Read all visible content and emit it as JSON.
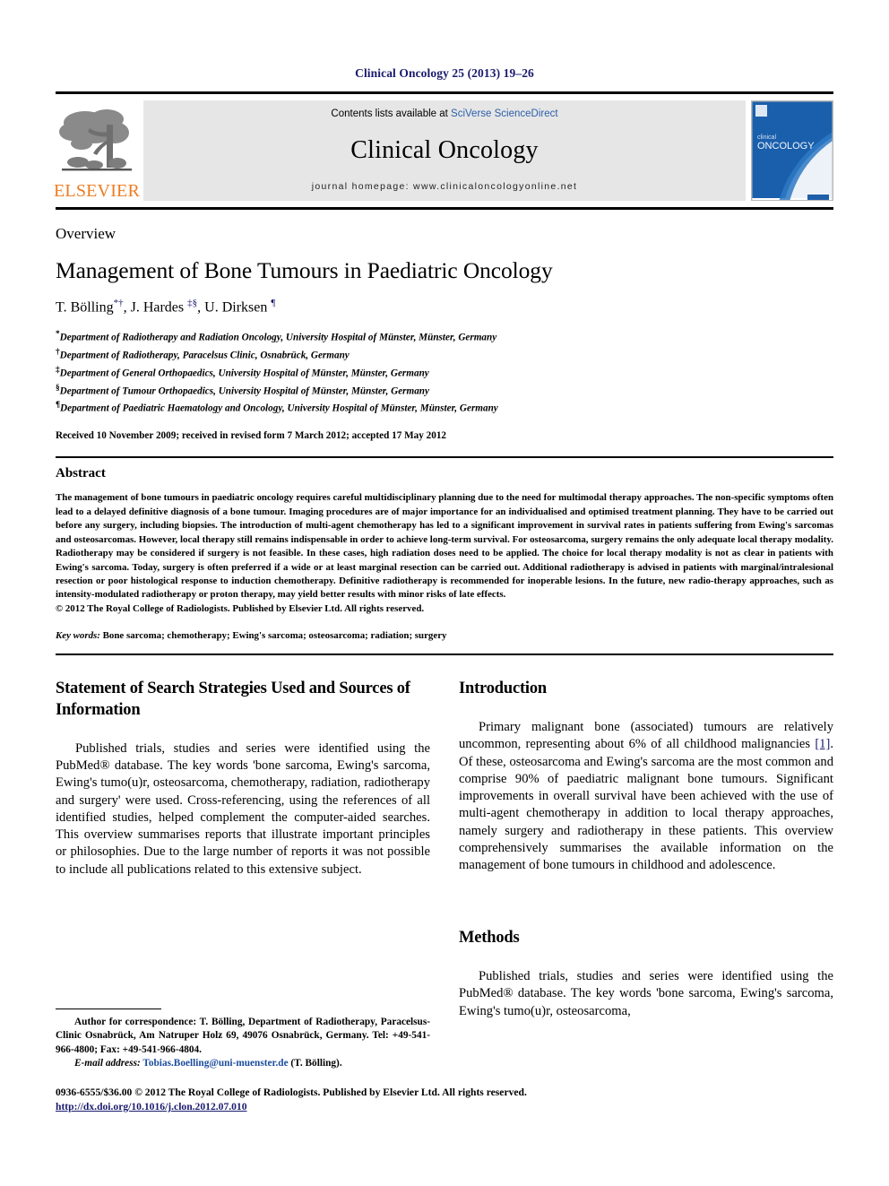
{
  "running_head": "Clinical Oncology 25 (2013) 19–26",
  "masthead": {
    "publisher_name": "ELSEVIER",
    "contents_prefix": "Contents lists available at ",
    "contents_link": "SciVerse ScienceDirect",
    "journal_name": "Clinical Oncology",
    "homepage": "journal homepage: www.clinicaloncologyonline.net",
    "cover_title_small": "clinical",
    "cover_title_large": "ONCOLOGY",
    "accent_blue": "#2b5faa",
    "elsevier_orange": "#ec7c22",
    "cover_blue": "#1a5fab"
  },
  "article": {
    "kicker": "Overview",
    "title": "Management of Bone Tumours in Paediatric Oncology",
    "authors_plain": "T. Bölling*†, J. Hardes ‡§, U. Dirksen ¶",
    "authors_parts": [
      {
        "name": "T. Bölling",
        "marks": "*†"
      },
      {
        "name": ", J. Hardes ",
        "marks": "‡§"
      },
      {
        "name": ", U. Dirksen ",
        "marks": "¶"
      }
    ],
    "affiliations": [
      {
        "mark": "*",
        "text": "Department of Radiotherapy and Radiation Oncology, University Hospital of Münster, Münster, Germany"
      },
      {
        "mark": "†",
        "text": "Department of Radiotherapy, Paracelsus Clinic, Osnabrück, Germany"
      },
      {
        "mark": "‡",
        "text": "Department of General Orthopaedics, University Hospital of Münster, Münster, Germany"
      },
      {
        "mark": "§",
        "text": "Department of Tumour Orthopaedics, University Hospital of Münster, Münster, Germany"
      },
      {
        "mark": "¶",
        "text": "Department of Paediatric Haematology and Oncology, University Hospital of Münster, Münster, Germany"
      }
    ],
    "received": "Received 10 November 2009; received in revised form 7 March 2012; accepted 17 May 2012"
  },
  "abstract": {
    "heading": "Abstract",
    "text": "The management of bone tumours in paediatric oncology requires careful multidisciplinary planning due to the need for multimodal therapy approaches. The non-specific symptoms often lead to a delayed definitive diagnosis of a bone tumour. Imaging procedures are of major importance for an individualised and optimised treatment planning. They have to be carried out before any surgery, including biopsies. The introduction of multi-agent chemotherapy has led to a significant improvement in survival rates in patients suffering from Ewing's sarcomas and osteosarcomas. However, local therapy still remains indispensable in order to achieve long-term survival. For osteosarcoma, surgery remains the only adequate local therapy modality. Radiotherapy may be considered if surgery is not feasible. In these cases, high radiation doses need to be applied. The choice for local therapy modality is not as clear in patients with Ewing's sarcoma. Today, surgery is often preferred if a wide or at least marginal resection can be carried out. Additional radiotherapy is advised in patients with marginal/intralesional resection or poor histological response to induction chemotherapy. Definitive radiotherapy is recommended for inoperable lesions. In the future, new radio-therapy approaches, such as intensity-modulated radiotherapy or proton therapy, may yield better results with minor risks of late effects.",
    "copyright": "© 2012 The Royal College of Radiologists. Published by Elsevier Ltd. All rights reserved.",
    "keywords_label": "Key words:",
    "keywords_text": " Bone sarcoma; chemotherapy; Ewing's sarcoma; osteosarcoma; radiation; surgery"
  },
  "left_column": {
    "heading": "Statement of Search Strategies Used and Sources of Information",
    "paragraph": "Published trials, studies and series were identified using the PubMed® database. The key words 'bone sarcoma, Ewing's sarcoma, Ewing's tumo(u)r, osteosarcoma, chemotherapy, radiation, radiotherapy and surgery' were used. Cross-referencing, using the references of all identified studies, helped complement the computer-aided searches. This overview summarises reports that illustrate important principles or philosophies. Due to the large number of reports it was not possible to include all publications related to this extensive subject."
  },
  "right_column": {
    "intro_heading": "Introduction",
    "intro_paragraph_pre": "Primary malignant bone (associated) tumours are relatively uncommon, representing about 6% of all childhood malignancies ",
    "intro_reference": "[1]",
    "intro_paragraph_post": ". Of these, osteosarcoma and Ewing's sarcoma are the most common and comprise 90% of paediatric malignant bone tumours. Significant improvements in overall survival have been achieved with the use of multi-agent chemotherapy in addition to local therapy approaches, namely surgery and radiotherapy in these patients. This overview comprehensively summarises the available information on the management of bone tumours in childhood and adolescence.",
    "methods_heading": "Methods",
    "methods_paragraph": "Published trials, studies and series were identified using the PubMed® database. The key words 'bone sarcoma, Ewing's sarcoma, Ewing's tumo(u)r, osteosarcoma,"
  },
  "footnote": {
    "correspondence": "Author for correspondence: T. Bölling, Department of Radiotherapy, Paracelsus-Clinic Osnabrück, Am Natruper Holz 69, 49076 Osnabrück, Germany. Tel: +49-541-966-4800; Fax: +49-541-966-4804.",
    "email_label": "E-mail address:",
    "email": "Tobias.Boelling@uni-muenster.de",
    "email_suffix": " (T. Bölling)."
  },
  "imprint": {
    "line1": "0936-6555/$36.00 © 2012 The Royal College of Radiologists. Published by Elsevier Ltd. All rights reserved.",
    "doi": "http://dx.doi.org/10.1016/j.clon.2012.07.010"
  }
}
